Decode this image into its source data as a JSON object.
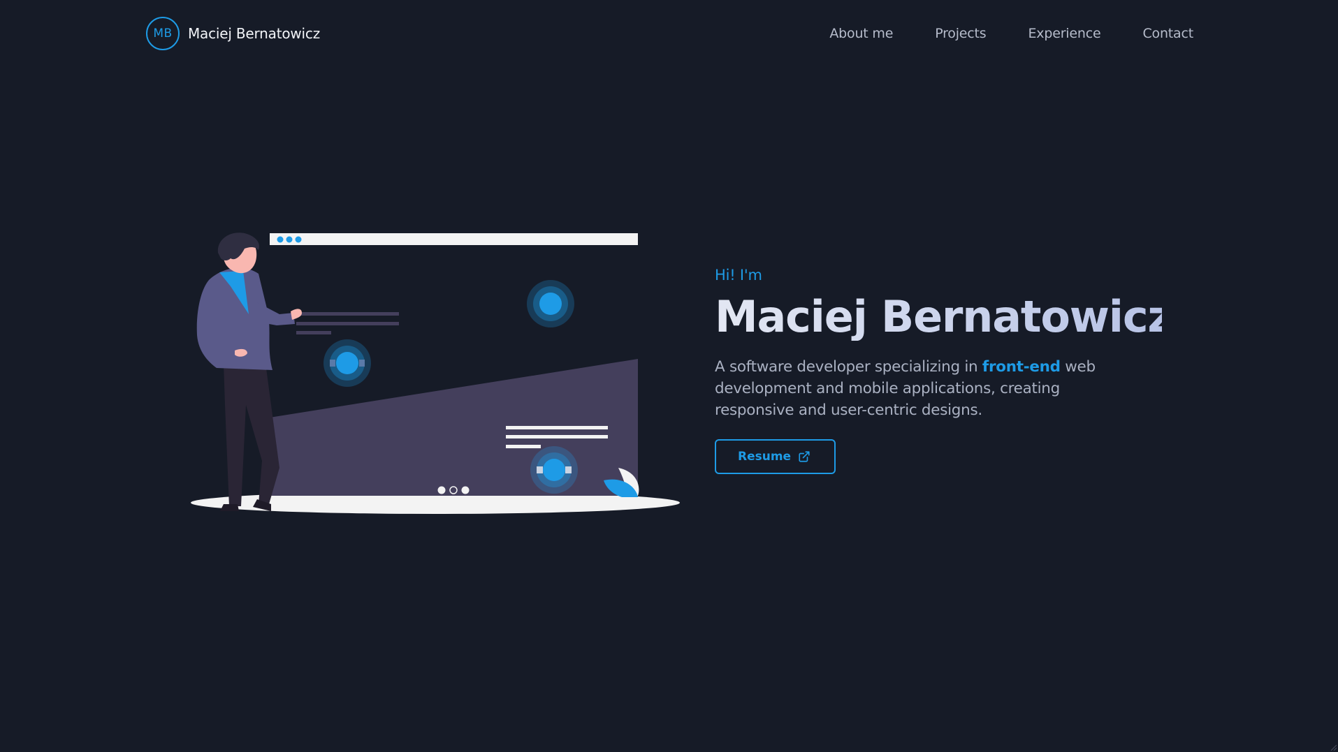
{
  "header": {
    "logo_initials": "MB",
    "brand_name": "Maciej Bernatowicz",
    "nav": [
      {
        "label": "About me"
      },
      {
        "label": "Projects"
      },
      {
        "label": "Experience"
      },
      {
        "label": "Contact"
      }
    ]
  },
  "hero": {
    "greeting": "Hi! I'm",
    "name": "Maciej Bernatowicz",
    "description_before": "A software developer specializing in ",
    "description_highlight": "front-end",
    "description_after": " web development and mobile applications, creating responsive and user-centric designs.",
    "resume_label": "Resume",
    "resume_icon": "external-link-icon"
  },
  "illustration": {
    "subject": "person-presenting-website-illustration"
  },
  "colors": {
    "background": "#161b27",
    "accent": "#1e9be6",
    "text_primary": "#f2f4f8",
    "text_secondary": "#aab1c2",
    "illustration_panel": "#443f5c",
    "illustration_jacket": "#5a5a8a"
  }
}
